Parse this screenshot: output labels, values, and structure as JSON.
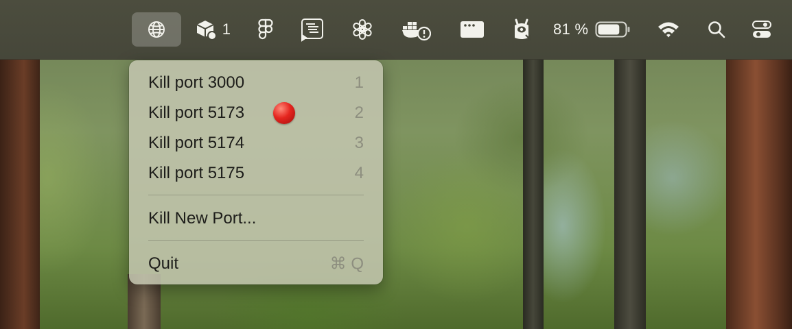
{
  "menubar": {
    "icons": [
      {
        "icon": "globe-icon",
        "active": true
      },
      {
        "icon": "package-icon",
        "badge": "1"
      },
      {
        "icon": "figma-icon"
      },
      {
        "icon": "script-runner-icon"
      },
      {
        "icon": "openai-icon"
      },
      {
        "icon": "docker-warning-icon"
      },
      {
        "icon": "window-dots-icon"
      },
      {
        "icon": "llama-icon"
      },
      {
        "icon": "battery-icon"
      },
      {
        "icon": "wifi-icon"
      },
      {
        "icon": "search-icon"
      },
      {
        "icon": "control-center-icon"
      }
    ],
    "battery_percent_label": "81 %",
    "battery_level": 0.81
  },
  "menu": {
    "items": [
      {
        "label": "Kill port 3000",
        "shortcut": "1"
      },
      {
        "label": "Kill port 5173",
        "shortcut": "2",
        "indicator": "red-dot"
      },
      {
        "label": "Kill port 5174",
        "shortcut": "3"
      },
      {
        "label": "Kill port 5175",
        "shortcut": "4"
      }
    ],
    "new_port_label": "Kill New Port...",
    "quit_label": "Quit",
    "quit_shortcut": "⌘ Q"
  },
  "colors": {
    "menubar_bg": "#4a4b3d",
    "menu_bg": "#c4c6b0",
    "indicator_red": "#e5251f"
  }
}
